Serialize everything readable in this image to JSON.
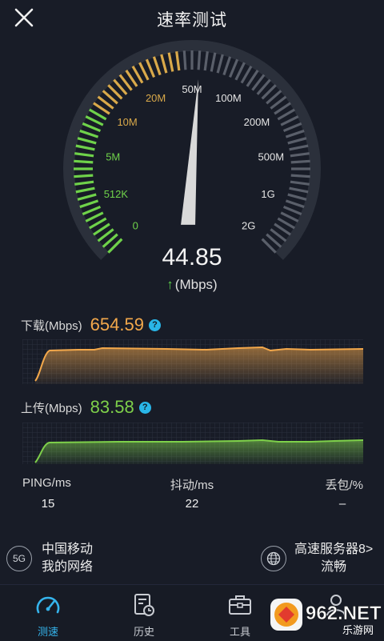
{
  "header": {
    "title": "速率测试",
    "close_icon": "close-icon"
  },
  "gauge": {
    "labels": [
      "0",
      "512K",
      "5M",
      "10M",
      "20M",
      "50M",
      "100M",
      "200M",
      "500M",
      "1G",
      "2G"
    ],
    "current_speed": "44.85",
    "unit": "(Mbps)",
    "arrow": "↑",
    "colors": {
      "low": "#6fd24a",
      "mid": "#d9a94a",
      "high": "#5a5f6a"
    }
  },
  "download": {
    "label": "下载(Mbps)",
    "value": "654.59",
    "help": "?",
    "color": "#f3a84b"
  },
  "upload": {
    "label": "上传(Mbps)",
    "value": "83.58",
    "help": "?",
    "color": "#7ed04a"
  },
  "stats": [
    {
      "label": "PING/ms",
      "value": "15"
    },
    {
      "label": "抖动/ms",
      "value": "22"
    },
    {
      "label": "丢包/%",
      "value": "–"
    }
  ],
  "network": {
    "badge": "5G",
    "line1": "中国移动",
    "line2": "我的网络"
  },
  "server": {
    "line1": "高速服务器8>",
    "line2": "流畅"
  },
  "nav": [
    {
      "label": "测速",
      "icon": "speedometer-icon",
      "active": true
    },
    {
      "label": "历史",
      "icon": "history-icon",
      "active": false
    },
    {
      "label": "工具",
      "icon": "toolbox-icon",
      "active": false
    },
    {
      "label": "",
      "icon": "profile-icon",
      "active": false
    }
  ],
  "watermark": {
    "text": "962.NET",
    "sub": "乐游网"
  }
}
